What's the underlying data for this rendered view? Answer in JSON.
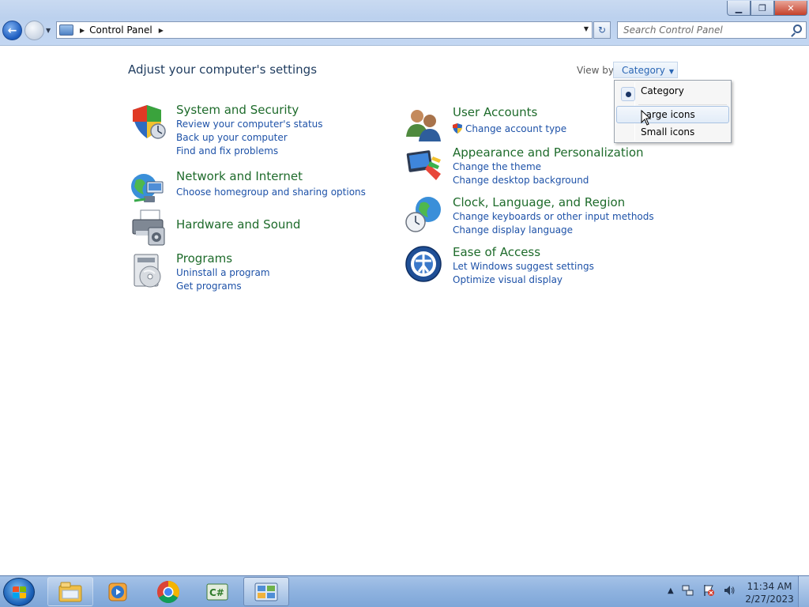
{
  "window": {
    "minimize_glyph": "▁",
    "maximize_glyph": "❐",
    "close_glyph": "✕"
  },
  "address_bar": {
    "breadcrumb": "Control Panel"
  },
  "search": {
    "placeholder": "Search Control Panel"
  },
  "page": {
    "heading": "Adjust your computer's settings",
    "view_by_label": "View by:",
    "view_by_value": "Category"
  },
  "categories": [
    {
      "title": "System and Security",
      "icon": "shield-icon",
      "links": [
        "Review your computer's status",
        "Back up your computer",
        "Find and fix problems"
      ]
    },
    {
      "title": "Network and Internet",
      "icon": "network-globe-icon",
      "links": [
        "Choose homegroup and sharing options"
      ]
    },
    {
      "title": "Hardware and Sound",
      "icon": "printer-speaker-icon",
      "links": []
    },
    {
      "title": "Programs",
      "icon": "programs-disc-icon",
      "links": [
        "Uninstall a program",
        "Get programs"
      ]
    },
    {
      "title": "User Accounts",
      "icon": "users-icon",
      "links": [
        "Change account type"
      ]
    },
    {
      "title": "Appearance and Personalization",
      "icon": "monitor-paint-icon",
      "links": [
        "Change the theme",
        "Change desktop background"
      ]
    },
    {
      "title": "Clock, Language, and Region",
      "icon": "globe-clock-icon",
      "links": [
        "Change keyboards or other input methods",
        "Change display language"
      ]
    },
    {
      "title": "Ease of Access",
      "icon": "ease-of-access-icon",
      "links": [
        "Let Windows suggest settings",
        "Optimize visual display"
      ]
    }
  ],
  "view_menu": {
    "items": [
      "Category",
      "Large icons",
      "Small icons"
    ],
    "selected": "Category",
    "hovered": "Large icons"
  },
  "taskbar": {
    "apps": [
      "windows-explorer-icon",
      "media-player-icon",
      "chrome-icon",
      "csharp-icon",
      "control-panel-icon"
    ],
    "active_app": "control-panel-icon",
    "clock_time": "11:34 AM",
    "clock_date": "2/27/2023"
  }
}
